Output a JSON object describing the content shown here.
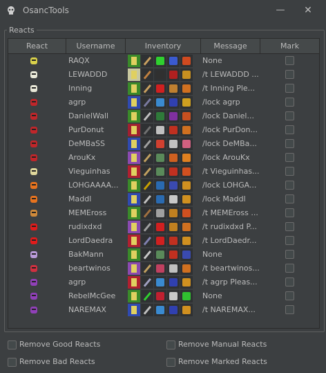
{
  "window": {
    "title": "OsancTools",
    "minimize_glyph": "—",
    "close_glyph": "✕",
    "icon": "skull-icon"
  },
  "group_label": "Reacts",
  "columns": [
    "React",
    "Username",
    "Inventory",
    "Message",
    "Mark"
  ],
  "rows": [
    {
      "username": "RAQX",
      "message": "None",
      "react_icon": "yellow-mask-icon",
      "react_color": "#d9d14a"
    },
    {
      "username": "LEWADDD",
      "message": "/t LEWADDD ...",
      "react_icon": "white-egg-icon",
      "react_color": "#e8e8d8"
    },
    {
      "username": "Inning",
      "message": "/t Inning Ple...",
      "react_icon": "white-egg-icon",
      "react_color": "#e8e8d8"
    },
    {
      "username": "agrp",
      "message": "/lock agrp",
      "react_icon": "red-helmet-icon",
      "react_color": "#c0262a"
    },
    {
      "username": "DanielWall",
      "message": "/lock Daniel...",
      "react_icon": "red-helmet-icon",
      "react_color": "#c0262a"
    },
    {
      "username": "PurDonut",
      "message": "/lock PurDon...",
      "react_icon": "red-helmet-icon",
      "react_color": "#c0262a"
    },
    {
      "username": "DeMBaSS",
      "message": "/lock DeMBa...",
      "react_icon": "red-helmet-icon",
      "react_color": "#c0262a"
    },
    {
      "username": "ArouKx",
      "message": "/lock ArouKx",
      "react_icon": "red-helmet-icon",
      "react_color": "#c0262a"
    },
    {
      "username": "Vieguinhas",
      "message": "/t Vieguinhas...",
      "react_icon": "skull-horns-icon",
      "react_color": "#e0d89c"
    },
    {
      "username": "LOHGAAAA...",
      "message": "/lock LOHGA...",
      "react_icon": "orange-star-icon",
      "react_color": "#e8731e"
    },
    {
      "username": "Maddl",
      "message": "/lock Maddl",
      "react_icon": "orange-star-icon",
      "react_color": "#e8731e"
    },
    {
      "username": "MEMEross",
      "message": "/t MEMEross ...",
      "react_icon": "potion-icon",
      "react_color": "#d08a3a"
    },
    {
      "username": "rudixdxd",
      "message": "/t rudixdxd P...",
      "react_icon": "red-arrow-icon",
      "react_color": "#e01b1b"
    },
    {
      "username": "LordDaedra",
      "message": "/t LordDaedr...",
      "react_icon": "red-arrow-icon",
      "react_color": "#e01b1b"
    },
    {
      "username": "BakMann",
      "message": "None",
      "react_icon": "purple-bottle-icon",
      "react_color": "#b89ad8"
    },
    {
      "username": "beartwinos",
      "message": "/t beartwinos...",
      "react_icon": "red-face-icon",
      "react_color": "#d03040"
    },
    {
      "username": "agrp",
      "message": "/t agrp Pleas...",
      "react_icon": "purple-crown-icon",
      "react_color": "#9040b8"
    },
    {
      "username": "RebelMcGee",
      "message": "None",
      "react_icon": "purple-crown-icon",
      "react_color": "#9040b8"
    },
    {
      "username": "NAREMAX",
      "message": "/t NAREMAX...",
      "react_icon": "purple-crown-icon",
      "react_color": "#9040b8"
    }
  ],
  "inventory_palette": [
    [
      "#3a8a2a",
      "#c8a060",
      "#2fd02f",
      "#3a5ad0",
      "#d04a20"
    ],
    [
      "#c8c8a0",
      "#c08040",
      "#303030",
      "#b02020",
      "#c89020"
    ],
    [
      "#3a8a2a",
      "#c8a060",
      "#d02020",
      "#c08030",
      "#d07020"
    ],
    [
      "#304ab0",
      "#7a7aa0",
      "#3a8ad0",
      "#3040b0",
      "#d0a020"
    ],
    [
      "#3a8a2a",
      "#c0c0c0",
      "#2f7a3a",
      "#8030a0",
      "#c85020"
    ],
    [
      "#a02030",
      "#707070",
      "#c0c0c0",
      "#c03020",
      "#d07020"
    ],
    [
      "#304ab0",
      "#a0a0a0",
      "#d04030",
      "#c0c0c0",
      "#d06080"
    ],
    [
      "#8a4ab0",
      "#c0a060",
      "#5a8a5a",
      "#d06020",
      "#e08020"
    ],
    [
      "#b02030",
      "#c0a060",
      "#5a8a5a",
      "#c03020",
      "#d05020"
    ],
    [
      "#3a8a2a",
      "#c8a000",
      "#2a6ab0",
      "#3a4ab0",
      "#d09020"
    ],
    [
      "#304ab0",
      "#c0c0c0",
      "#2a6ab0",
      "#c8c8c8",
      "#d09020"
    ],
    [
      "#3a8a2a",
      "#a07040",
      "#a0a0a0",
      "#c08020",
      "#d05020"
    ],
    [
      "#8a4ab0",
      "#a0a0a0",
      "#d02020",
      "#c08020",
      "#d07020"
    ],
    [
      "#b02030",
      "#8080b0",
      "#d02020",
      "#c03020",
      "#d09020"
    ],
    [
      "#3a8a2a",
      "#c8c8c8",
      "#5a8a5a",
      "#c03020",
      "#3a4ab0"
    ],
    [
      "#8a4ab0",
      "#c0a060",
      "#c04060",
      "#c0c0c0",
      "#d07020"
    ],
    [
      "#b02030",
      "#a0a0c0",
      "#3a8ad0",
      "#3040b0",
      "#d09020"
    ],
    [
      "#3a8a2a",
      "#30d030",
      "#c02030",
      "#c8c8c8",
      "#30c030"
    ],
    [
      "#304ab0",
      "#c0c0c0",
      "#3a8ad0",
      "#3040b0",
      "#d09020"
    ]
  ],
  "options": {
    "remove_good": "Remove Good Reacts",
    "remove_manual": "Remove Manual Reacts",
    "remove_bad": "Remove Bad Reacts",
    "remove_marked": "Remove Marked Reacts"
  }
}
